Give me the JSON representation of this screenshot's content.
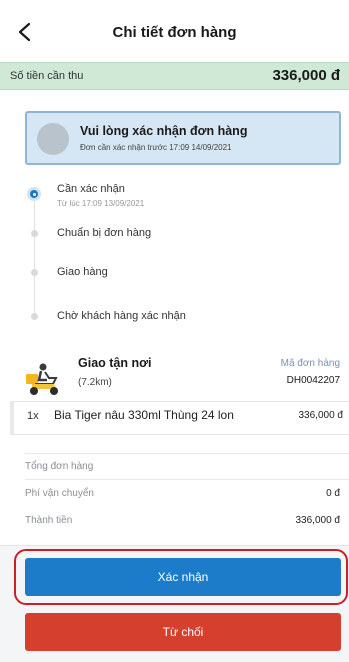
{
  "header": {
    "title": "Chi tiết đơn hàng"
  },
  "amount_due": {
    "label": "Số tiền cần thu",
    "value": "336,000 đ"
  },
  "confirm_notice": {
    "title": "Vui lòng xác nhận đơn hàng",
    "subtitle": "Đơn cần xác nhận trước 17:09 14/09/2021"
  },
  "timeline": {
    "steps": [
      {
        "label": "Cần xác nhận",
        "sub": "Từ lúc 17:09 13/09/2021"
      },
      {
        "label": "Chuẩn bị đơn hàng"
      },
      {
        "label": "Giao hàng"
      },
      {
        "label": "Chờ khách hàng xác nhận"
      }
    ]
  },
  "delivery": {
    "method": "Giao tận nơi",
    "distance": "(7.2km)",
    "order_id_label": "Mã đơn hàng",
    "order_id": "DH0042207"
  },
  "items": [
    {
      "qty": "1x",
      "name": "Bia Tiger nâu 330ml Thùng 24 lon",
      "price": "336,000 đ"
    }
  ],
  "summary": {
    "total_label": "Tổng đơn hàng",
    "shipping_label": "Phí vận chuyển",
    "shipping_value": "0 đ",
    "grand_label": "Thành tiền",
    "grand_value": "336,000 đ"
  },
  "actions": {
    "confirm": "Xác nhận",
    "reject": "Từ chối"
  },
  "colors": {
    "primary": "#1d7cc9",
    "danger": "#d5402e",
    "success_bg": "#cfe9d6",
    "highlight": "#c8202a"
  }
}
